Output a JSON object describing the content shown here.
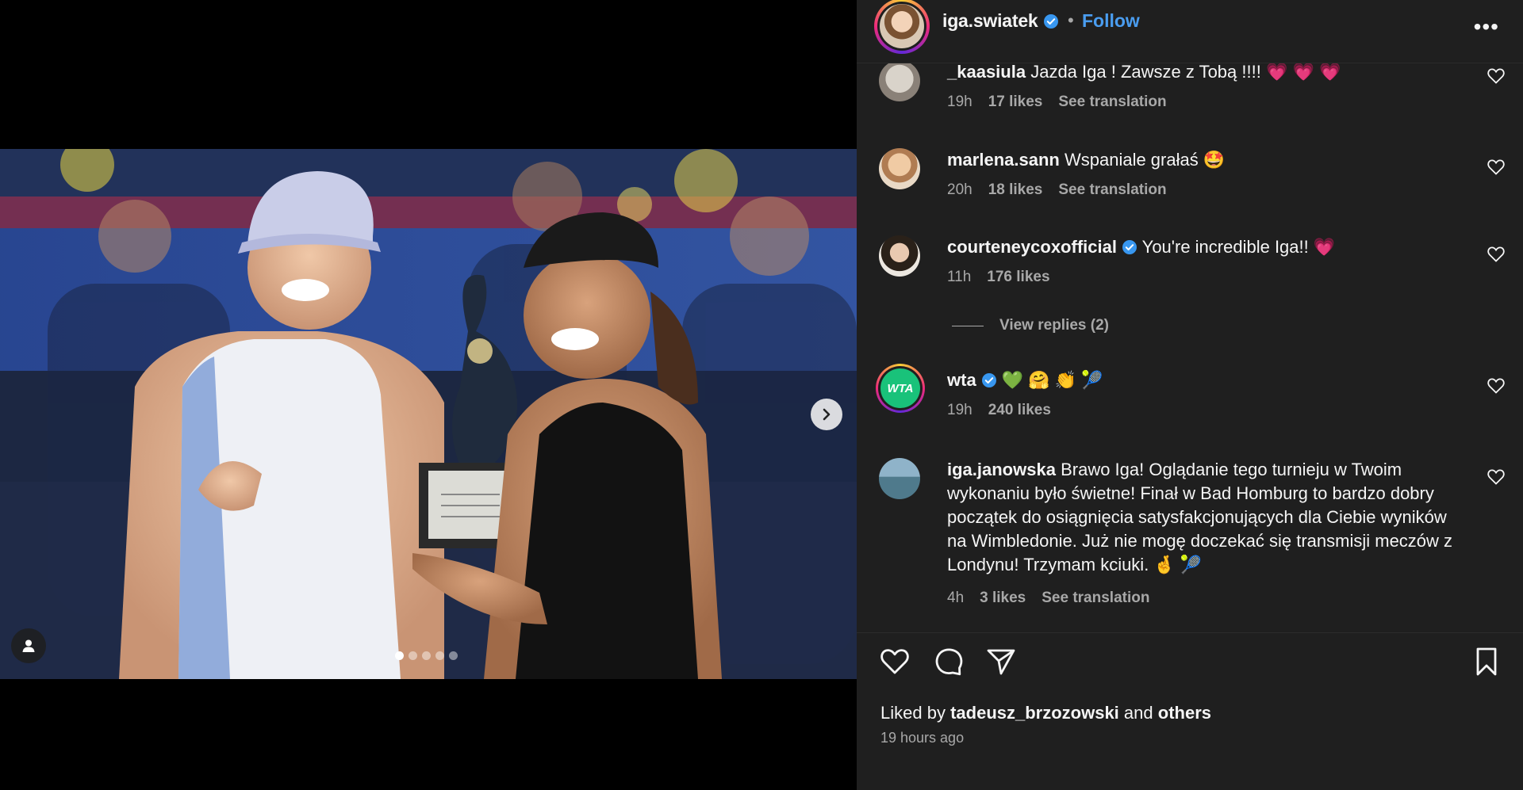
{
  "post": {
    "username": "iga.swiatek",
    "dot": "•",
    "follow_label": "Follow",
    "more_label": "•••"
  },
  "carousel": {
    "slide_count": 5,
    "active_index": 0
  },
  "comments": [
    {
      "user": "_kaasiula",
      "text": "Jazda Iga ! Zawsze z Tobą !!!! 💗 💗 💗",
      "time": "19h",
      "likes": "17 likes",
      "action": "See translation"
    },
    {
      "user": "marlena.sann",
      "text": "Wspaniale grałaś 🤩",
      "time": "20h",
      "likes": "18 likes",
      "action": "See translation"
    },
    {
      "user": "courteneycoxofficial",
      "text": "You're incredible Iga!! 💗",
      "time": "11h",
      "likes": "176 likes",
      "action": ""
    },
    {
      "user": "wta",
      "text": "💚 🤗 👏 🎾",
      "time": "19h",
      "likes": "240 likes",
      "action": ""
    },
    {
      "user": "iga.janowska",
      "text": "Brawo Iga! Oglądanie tego turnieju w Twoim wykonaniu było świetne! Finał w Bad Homburg to bardzo dobry początek do osiągnięcia satysfakcjonujących dla Ciebie wyników na Wimbledonie. Już nie mogę doczekać się transmisji meczów z Londynu! Trzymam kciuki. 🤞 🎾",
      "time": "4h",
      "likes": "3 likes",
      "action": "See translation"
    }
  ],
  "replies_label": "View replies (2)",
  "wta_logo_text": "WTA",
  "footer": {
    "liked_by_prefix": "Liked by",
    "liked_by_user": "tadeusz_brzozowski",
    "liked_by_and": "and",
    "liked_by_others": "others",
    "time_ago": "19 hours ago"
  },
  "colors": {
    "panel_bg": "#1f1f1f",
    "follow_blue": "#4a9df0",
    "verified_blue": "#3897f0",
    "muted_text": "#a8a8a8"
  }
}
